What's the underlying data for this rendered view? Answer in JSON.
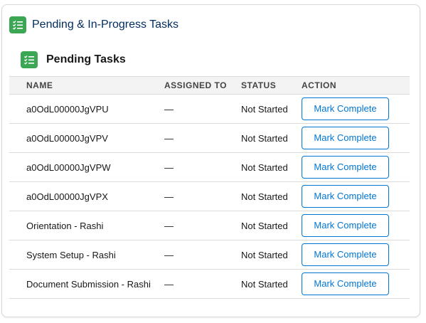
{
  "card": {
    "title": "Pending & In-Progress Tasks",
    "icon": "task-list-icon"
  },
  "section": {
    "title": "Pending Tasks",
    "icon": "task-list-icon"
  },
  "colors": {
    "icon_bg": "#3ba755",
    "title": "#032d60",
    "button": "#0176d3"
  },
  "table": {
    "headers": {
      "name": "NAME",
      "assigned": "ASSIGNED TO",
      "status": "STATUS",
      "action": "ACTION"
    },
    "rows": [
      {
        "name": "a0OdL00000JgVPU",
        "assigned": "—",
        "status": "Not Started",
        "action": "Mark Complete"
      },
      {
        "name": "a0OdL00000JgVPV",
        "assigned": "—",
        "status": "Not Started",
        "action": "Mark Complete"
      },
      {
        "name": "a0OdL00000JgVPW",
        "assigned": "—",
        "status": "Not Started",
        "action": "Mark Complete"
      },
      {
        "name": "a0OdL00000JgVPX",
        "assigned": "—",
        "status": "Not Started",
        "action": "Mark Complete"
      },
      {
        "name": "Orientation - Rashi",
        "assigned": "—",
        "status": "Not Started",
        "action": "Mark Complete"
      },
      {
        "name": "System Setup - Rashi",
        "assigned": "—",
        "status": "Not Started",
        "action": "Mark Complete"
      },
      {
        "name": "Document Submission - Rashi",
        "assigned": "—",
        "status": "Not Started",
        "action": "Mark Complete"
      }
    ]
  }
}
